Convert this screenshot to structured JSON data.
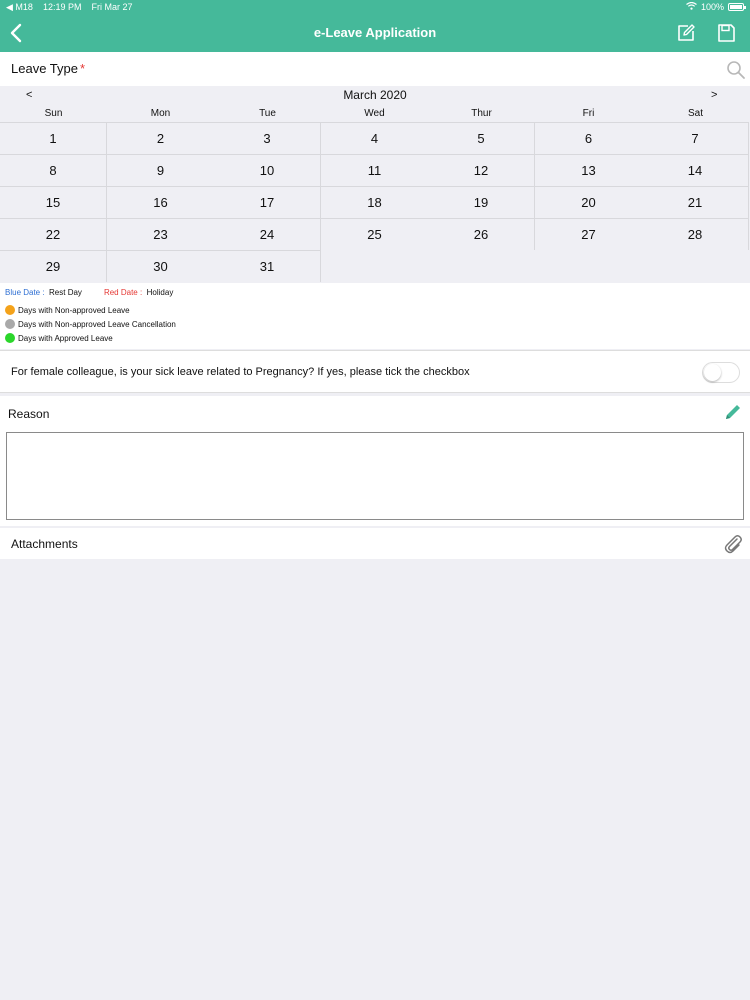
{
  "status_bar": {
    "carrier": "◀ M18",
    "time": "12:19 PM",
    "date": "Fri Mar 27",
    "battery": "100%"
  },
  "nav": {
    "title": "e-Leave Application",
    "icons": [
      "back-chevron",
      "edit",
      "save"
    ]
  },
  "leave_type": {
    "label": "Leave Type",
    "required_mark": "*"
  },
  "calendar": {
    "month": "March 2020",
    "prev": "<",
    "next": ">",
    "weekdays": [
      "Sun",
      "Mon",
      "Tue",
      "Wed",
      "Thur",
      "Fri",
      "Sat"
    ],
    "days": [
      "1",
      "2",
      "3",
      "4",
      "5",
      "6",
      "7",
      "8",
      "9",
      "10",
      "11",
      "12",
      "13",
      "14",
      "15",
      "16",
      "17",
      "18",
      "19",
      "20",
      "21",
      "22",
      "23",
      "24",
      "25",
      "26",
      "27",
      "28",
      "29",
      "30",
      "31"
    ]
  },
  "legend": {
    "blue_date": "Blue Date :",
    "blue_meaning": "Rest Day",
    "red_date": "Red Date :",
    "red_meaning": "Holiday",
    "items": [
      {
        "label": "Days with Non-approved Leave",
        "color": "#f4a21a"
      },
      {
        "label": "Days with Non-approved Leave Cancellation",
        "color": "#a9a9a9"
      },
      {
        "label": "Days with Approved Leave",
        "color": "#2bd62b"
      }
    ]
  },
  "pregnancy": {
    "question": "For female colleague, is your sick leave related to Pregnancy? If yes, please tick the checkbox",
    "toggle_on": false
  },
  "reason": {
    "label": "Reason",
    "value": ""
  },
  "attachments": {
    "label": "Attachments"
  },
  "colors": {
    "accent": "#45b99a",
    "required": "#e53935",
    "rest_day": "#2e6fd3",
    "holiday": "#e53935"
  }
}
